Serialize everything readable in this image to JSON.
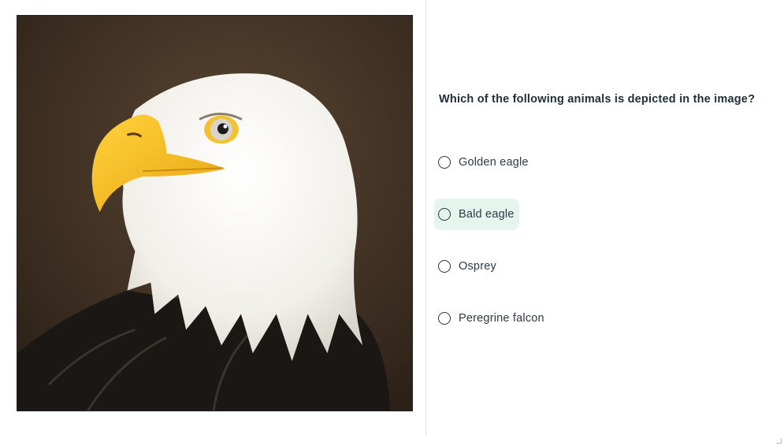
{
  "image": {
    "alt": "Bald eagle"
  },
  "question": {
    "text": "Which of the following animals is depicted in the image?"
  },
  "options": [
    {
      "label": "Golden eagle",
      "selected": false,
      "highlighted": false
    },
    {
      "label": "Bald eagle",
      "selected": false,
      "highlighted": true
    },
    {
      "label": "Osprey",
      "selected": false,
      "highlighted": false
    },
    {
      "label": "Peregrine falcon",
      "selected": false,
      "highlighted": false
    }
  ],
  "colors": {
    "highlight_background": "#e5f4ec",
    "text": "#2f3a44"
  }
}
